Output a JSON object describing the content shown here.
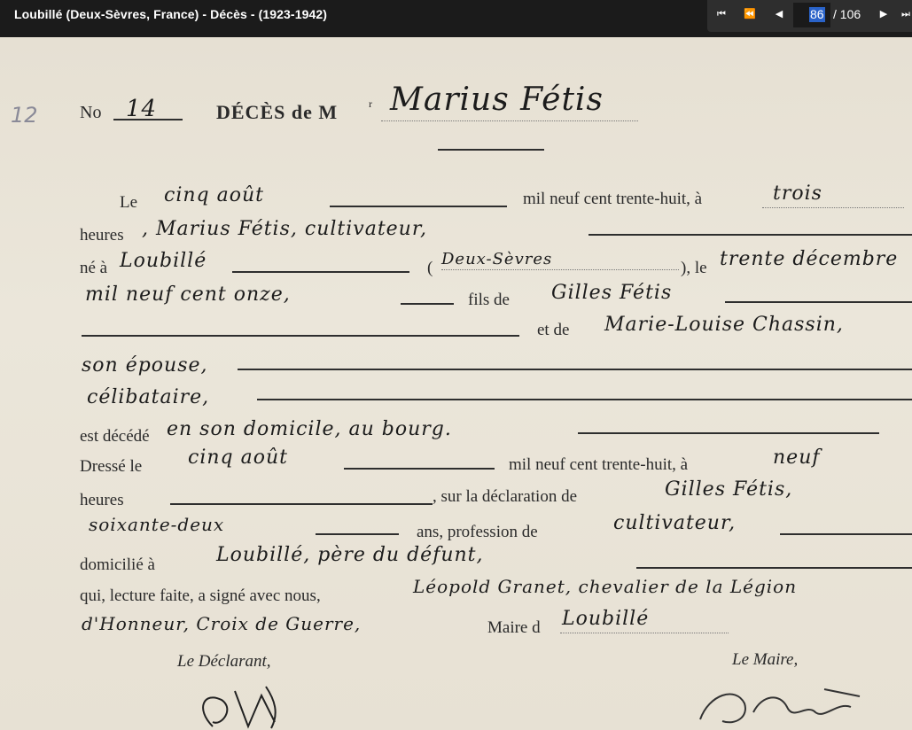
{
  "toolbar": {
    "title": "Loubillé (Deux-Sèvres, France) - Décès - (1923-1942)",
    "first_icon": "first-page-icon",
    "prev10_icon": "fast-rewind-icon",
    "prev_icon": "previous-page-icon",
    "next_icon": "next-page-icon",
    "last_icon": "last-page-icon",
    "current_page": "86",
    "total_pages": "/ 106"
  },
  "document": {
    "margin_note": "12",
    "number_label": "No",
    "number_value": "14",
    "heading": "DÉCÈS de M",
    "heading_sup": "r",
    "deceased_name": "Marius Fétis",
    "rows": {
      "le": "Le",
      "date_hand": "cinq août",
      "year_print": "mil neuf cent trente-huit, à",
      "hour_hand": "trois",
      "heures": "heures",
      "name_hand": ", Marius Fétis, cultivateur,",
      "ne_a": "né à",
      "birthplace_hand": "Loubillé",
      "dept_hand": "Deux-Sèvres",
      "le2": "), le",
      "birth_date_hand": "trente décembre",
      "birth_year_hand": "mil neuf cent onze,",
      "fils_de": "fils de",
      "father_hand": "Gilles Fétis",
      "et_de": "et de",
      "mother_hand": "Marie-Louise Chassin,",
      "spouse_hand": "son épouse,",
      "status_hand": "célibataire,",
      "est_decede": "est décédé",
      "place_hand": "en son domicile, au bourg.",
      "dresse_le": "Dressé le",
      "dresse_date_hand": "cinq août",
      "dresse_year": "mil neuf cent trente-huit, à",
      "dresse_hour_hand": "neuf",
      "heures2": "heures",
      "declaration": ", sur la déclaration de",
      "declarant_hand": "Gilles Fétis,",
      "age_hand": "soixante-deux",
      "ans_profession": "ans, profession de",
      "profession_hand": "cultivateur,",
      "domicilie": "domicilié à",
      "domicile_hand": "Loubillé, père du défunt,",
      "lecture": "qui, lecture faite, a signé avec nous,",
      "mayor_hand": "Léopold Granet, chevalier de la Légion",
      "honor_hand": "d'Honneur, Croix de Guerre,",
      "maire_de": "Maire d",
      "town_hand": "Loubillé",
      "le_declarant": "Le Déclarant,",
      "le_maire": "Le Maire,"
    }
  }
}
